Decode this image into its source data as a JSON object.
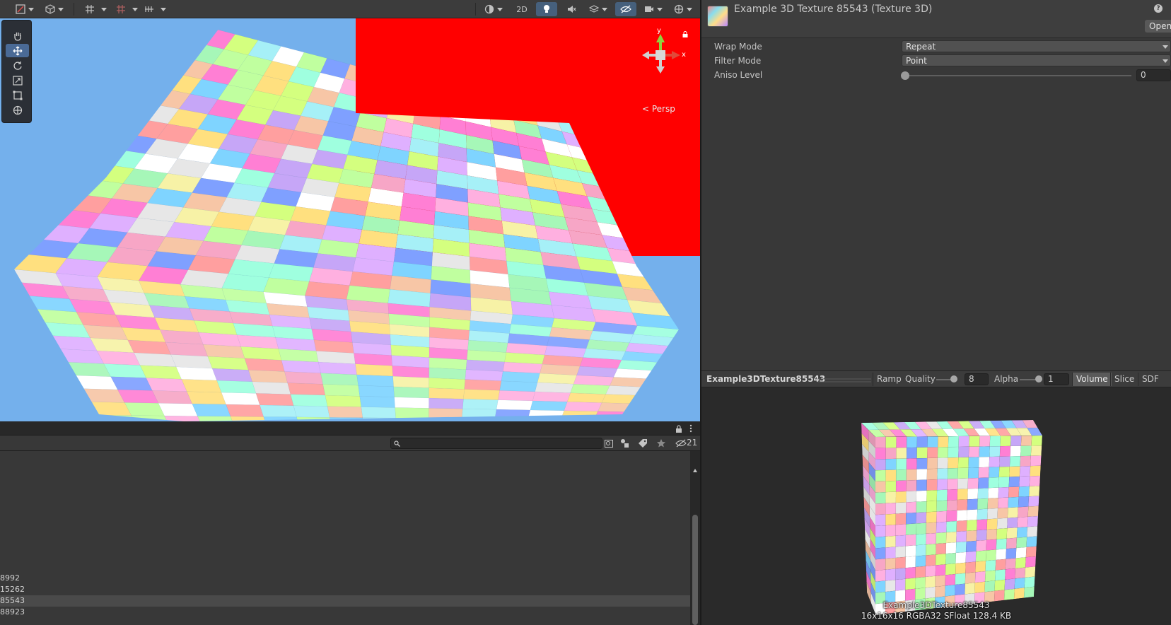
{
  "scene": {
    "toolbar": {
      "btn_2d": "2D"
    },
    "tools": [
      "hand-tool",
      "move-tool",
      "rotate-tool",
      "scale-tool",
      "rect-tool",
      "transform-tool"
    ],
    "gizmo": {
      "axis_y": "y",
      "axis_x": "x",
      "persp_label": "< Persp"
    },
    "background_colors": {
      "sky": "#74b0ec",
      "red_wall": "#ff0000"
    }
  },
  "hierarchy": {
    "visible_count": "21",
    "rows": [
      {
        "label": "8992",
        "selected": false
      },
      {
        "label": "15262",
        "selected": false
      },
      {
        "label": "85543",
        "selected": true
      },
      {
        "label": "88923",
        "selected": false
      }
    ]
  },
  "inspector": {
    "title": "Example 3D Texture 85543 (Texture 3D)",
    "open_button": "Open",
    "help_icon": "?",
    "properties": {
      "wrap_mode_label": "Wrap Mode",
      "wrap_mode_value": "Repeat",
      "filter_mode_label": "Filter Mode",
      "filter_mode_value": "Point",
      "aniso_label": "Aniso Level",
      "aniso_value": "0"
    }
  },
  "preview": {
    "asset_name": "Example3DTexture85543",
    "ramp": "Ramp",
    "quality_label": "Quality",
    "quality_value": "8",
    "alpha_label": "Alpha",
    "alpha_value": "1",
    "mode_volume": "Volume",
    "mode_slice": "Slice",
    "mode_sdf": "SDF",
    "caption_name": "Example3DTexture85543",
    "caption_info": "16x16x16 RGBA32 SFloat 128.4 KB"
  }
}
